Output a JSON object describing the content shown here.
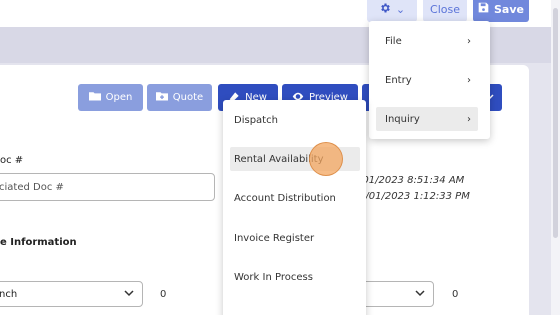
{
  "topbar": {
    "gear_menu_caret": "⌄",
    "close_label": "Close",
    "save_label": "Save"
  },
  "toolbar": {
    "open_label": "Open",
    "quote_label": "Quote",
    "new_label": "New",
    "preview_label": "Preview"
  },
  "form": {
    "doc_label": "oc #",
    "doc_placeholder": "ciated Doc #",
    "info_label": "e Information",
    "branch_value": "nch",
    "left_count": "0",
    "right_count": "0",
    "date_1": "/01/2023 8:51:34 AM",
    "date_2": "6/01/2023 1:12:33 PM"
  },
  "gear_menu": {
    "items": [
      {
        "label": "File",
        "arrow": "›"
      },
      {
        "label": "Entry",
        "arrow": "›"
      },
      {
        "label": "Inquiry",
        "arrow": "›"
      }
    ]
  },
  "inquiry_menu": {
    "items": [
      {
        "label": "Dispatch"
      },
      {
        "label": "Rental Availability"
      },
      {
        "label": "Account Distribution"
      },
      {
        "label": "Invoice Register"
      },
      {
        "label": "Work In Process"
      }
    ]
  },
  "colors": {
    "primary": "#2f4dbf",
    "primary_light": "#8a9ede",
    "save": "#7188dc",
    "cursor": "#f3a65f"
  }
}
